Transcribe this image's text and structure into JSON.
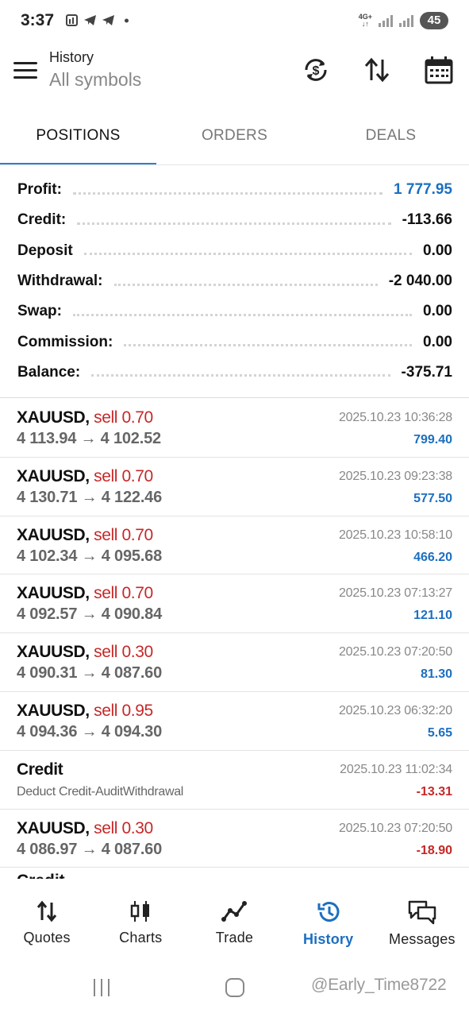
{
  "status_bar": {
    "time": "3:37",
    "network": "4G+",
    "battery": "45"
  },
  "header": {
    "title": "History",
    "subtitle": "All symbols"
  },
  "tabs": [
    {
      "label": "POSITIONS",
      "active": true
    },
    {
      "label": "ORDERS",
      "active": false
    },
    {
      "label": "DEALS",
      "active": false
    }
  ],
  "summary": [
    {
      "label": "Profit:",
      "value": "1 777.95"
    },
    {
      "label": "Credit:",
      "value": "-113.66"
    },
    {
      "label": "Deposit",
      "value": "0.00"
    },
    {
      "label": "Withdrawal:",
      "value": "-2 040.00"
    },
    {
      "label": "Swap:",
      "value": "0.00"
    },
    {
      "label": "Commission:",
      "value": "0.00"
    },
    {
      "label": "Balance:",
      "value": "-375.71"
    }
  ],
  "deals": [
    {
      "symbol": "XAUUSD,",
      "side": "sell 0.70",
      "prices": "4 113.94 → 4 102.52",
      "time": "2025.10.23 10:36:28",
      "profit": "799.40",
      "sign": "pos"
    },
    {
      "symbol": "XAUUSD,",
      "side": "sell 0.70",
      "prices": "4 130.71 → 4 122.46",
      "time": "2025.10.23 09:23:38",
      "profit": "577.50",
      "sign": "pos"
    },
    {
      "symbol": "XAUUSD,",
      "side": "sell 0.70",
      "prices": "4 102.34 → 4 095.68",
      "time": "2025.10.23 10:58:10",
      "profit": "466.20",
      "sign": "pos"
    },
    {
      "symbol": "XAUUSD,",
      "side": "sell 0.70",
      "prices": "4 092.57 → 4 090.84",
      "time": "2025.10.23 07:13:27",
      "profit": "121.10",
      "sign": "pos"
    },
    {
      "symbol": "XAUUSD,",
      "side": "sell 0.30",
      "prices": "4 090.31 → 4 087.60",
      "time": "2025.10.23 07:20:50",
      "profit": "81.30",
      "sign": "pos"
    },
    {
      "symbol": "XAUUSD,",
      "side": "sell 0.95",
      "prices": "4 094.36 → 4 094.30",
      "time": "2025.10.23 06:32:20",
      "profit": "5.65",
      "sign": "pos"
    },
    {
      "symbol": "Credit",
      "side": "",
      "desc": "Deduct Credit-AuditWithdrawal",
      "time": "2025.10.23 11:02:34",
      "profit": "-13.31",
      "sign": "neg"
    },
    {
      "symbol": "XAUUSD,",
      "side": "sell 0.30",
      "prices": "4 086.97 → 4 087.60",
      "time": "2025.10.23 07:20:50",
      "profit": "-18.90",
      "sign": "neg"
    }
  ],
  "partial_row_label": "Credit",
  "bottom_nav": [
    {
      "label": "Quotes",
      "icon": "quotes-icon",
      "active": false
    },
    {
      "label": "Charts",
      "icon": "charts-icon",
      "active": false
    },
    {
      "label": "Trade",
      "icon": "trade-icon",
      "active": false
    },
    {
      "label": "History",
      "icon": "history-icon",
      "active": true
    },
    {
      "label": "Messages",
      "icon": "messages-icon",
      "active": false
    }
  ],
  "watermark": "@Early_Time8722",
  "colors": {
    "accent_blue": "#1c6fc0",
    "sell_red": "#c62828",
    "tab_indicator": "#2e7fd1"
  }
}
